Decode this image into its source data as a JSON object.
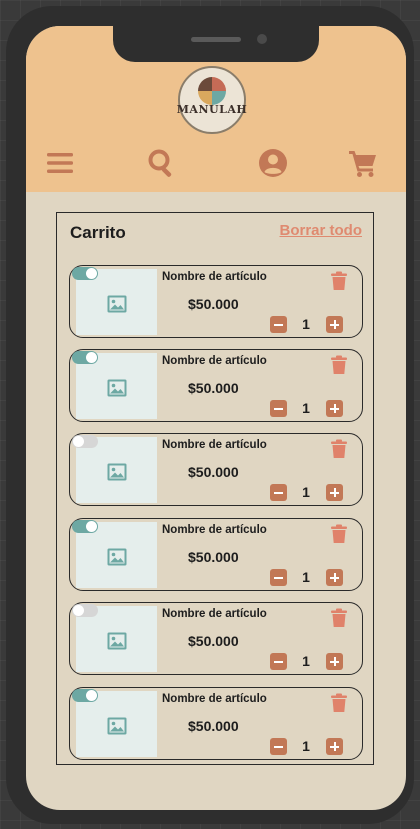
{
  "app": {
    "logo_text": "MANULAH"
  },
  "nav": {
    "icons": [
      "menu-icon",
      "search-icon",
      "account-icon",
      "cart-icon"
    ]
  },
  "cart": {
    "title": "Carrito",
    "clear_label": "Borrar todo",
    "items": [
      {
        "name": "Nombre de artículo",
        "price": "$50.000",
        "qty": "1",
        "selected": true
      },
      {
        "name": "Nombre de artículo",
        "price": "$50.000",
        "qty": "1",
        "selected": true
      },
      {
        "name": "Nombre de artículo",
        "price": "$50.000",
        "qty": "1",
        "selected": false
      },
      {
        "name": "Nombre de artículo",
        "price": "$50.000",
        "qty": "1",
        "selected": true
      },
      {
        "name": "Nombre de artículo",
        "price": "$50.000",
        "qty": "1",
        "selected": false
      },
      {
        "name": "Nombre de artículo",
        "price": "$50.000",
        "qty": "1",
        "selected": true
      }
    ]
  },
  "colors": {
    "header": "#eec28e",
    "background": "#e0d6c2",
    "accent": "#c27856",
    "link": "#df8a70",
    "toggle_on": "#6da8a3",
    "toggle_off": "#d6d6d6",
    "trash": "#e0826a"
  }
}
